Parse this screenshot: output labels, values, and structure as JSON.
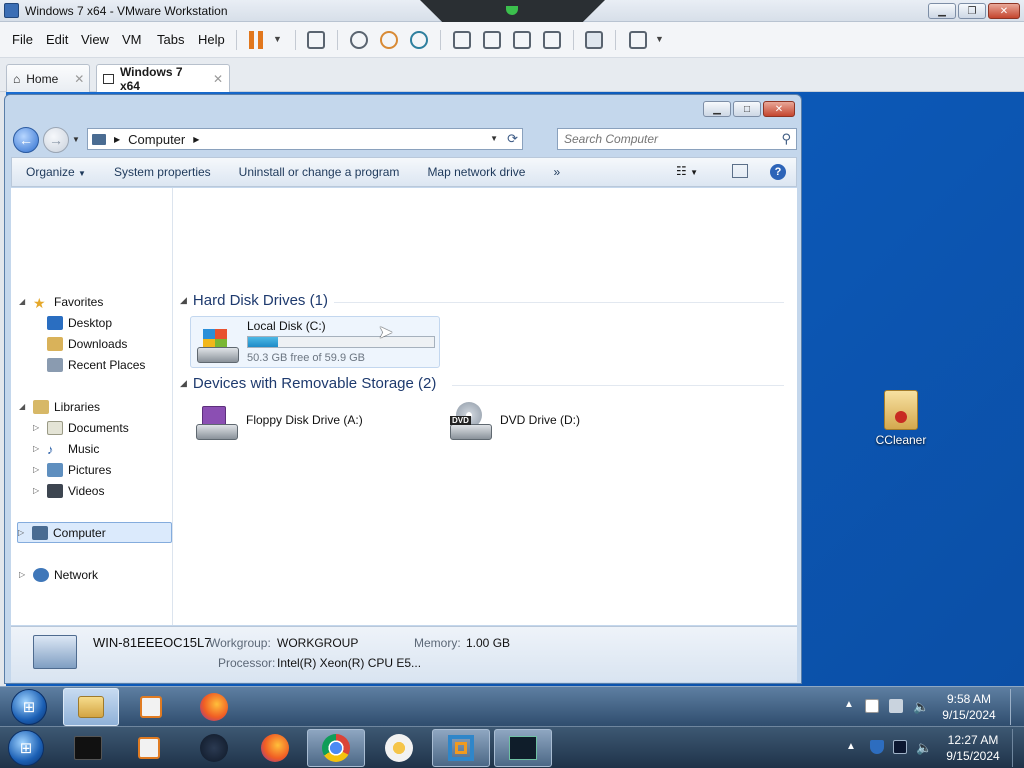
{
  "host": {
    "window_title": "Windows 7 x64 - VMware Workstation",
    "menu": [
      "File",
      "Edit",
      "View",
      "VM",
      "Tabs",
      "Help"
    ],
    "tabs": [
      {
        "label": "Home",
        "icon": "home-icon",
        "active": false
      },
      {
        "label": "Windows 7 x64",
        "icon": "vm-icon",
        "active": true
      }
    ]
  },
  "explorer": {
    "address": {
      "root_icon": "computer-icon",
      "crumb": "Computer"
    },
    "search_placeholder": "Search Computer",
    "commands": [
      "Organize",
      "System properties",
      "Uninstall or change a program",
      "Map network drive",
      "»"
    ],
    "nav": {
      "favorites": {
        "label": "Favorites",
        "items": [
          "Desktop",
          "Downloads",
          "Recent Places"
        ]
      },
      "libraries": {
        "label": "Libraries",
        "items": [
          "Documents",
          "Music",
          "Pictures",
          "Videos"
        ]
      },
      "computer": "Computer",
      "network": "Network"
    },
    "groups": {
      "hdd": {
        "title": "Hard Disk Drives (1)",
        "drives": [
          {
            "name": "Local Disk (C:)",
            "free_text": "50.3 GB free of 59.9 GB",
            "used_fraction": 0.16
          }
        ]
      },
      "removable": {
        "title": "Devices with Removable Storage (2)",
        "drives": [
          {
            "name": "Floppy Disk Drive (A:)",
            "icon": "floppy-drive-icon"
          },
          {
            "name": "DVD Drive (D:)",
            "icon": "dvd-drive-icon",
            "badge": "DVD"
          }
        ]
      }
    },
    "details": {
      "computer_name": "WIN-81EEEOC15L7",
      "workgroup_label": "Workgroup:",
      "workgroup": "WORKGROUP",
      "memory_label": "Memory:",
      "memory": "1.00 GB",
      "processor_label": "Processor:",
      "processor": "Intel(R) Xeon(R) CPU E5..."
    }
  },
  "desktop": {
    "icons": [
      {
        "label": "CCleaner",
        "icon": "folder-icon"
      }
    ]
  },
  "guest_taskbar": {
    "apps": [
      "explorer-icon",
      "media-player-icon",
      "firefox-icon"
    ],
    "time": "9:58 AM",
    "date": "9/15/2024"
  },
  "host_taskbar": {
    "apps": [
      "start-orb-icon",
      "terminal-icon",
      "media-player-icon",
      "app-icon",
      "firefox-icon",
      "chrome-icon",
      "vpn-icon",
      "vmware-icon",
      "monitor-icon"
    ],
    "time": "12:27 AM",
    "date": "9/15/2024"
  },
  "colors": {
    "desktop_blue": "#1565c8",
    "usage_bar": "#1e8bc7",
    "pause_orange": "#e1771d"
  }
}
